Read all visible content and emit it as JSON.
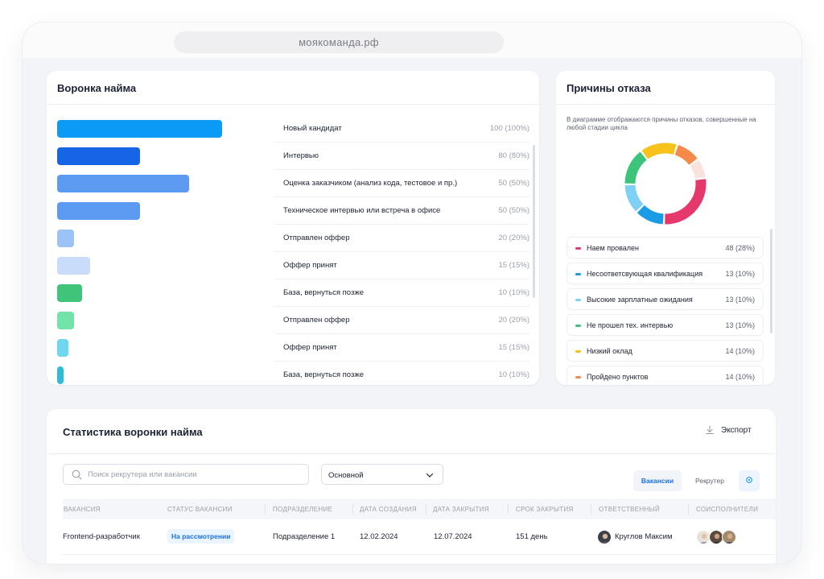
{
  "browser": {
    "url": "моякоманда.рф"
  },
  "funnel": {
    "title": "Воронка найма",
    "rows": [
      {
        "label": "Новый кандидат",
        "value": "100 (100%)",
        "fill": 1.0,
        "color": "#0b9af5"
      },
      {
        "label": "Интервью",
        "value": "80 (80%)",
        "fill": 0.5,
        "color": "#1565e6"
      },
      {
        "label": "Оценка заказчиком (анализ кода, тестовое и пр.)",
        "value": "50 (50%)",
        "fill": 0.8,
        "color": "#5d9af2"
      },
      {
        "label": "Техническое интервью или встреча в офисе",
        "value": "50 (50%)",
        "fill": 0.5,
        "color": "#5d9af2"
      },
      {
        "label": "Отправлен оффер",
        "value": "20 (20%)",
        "fill": 0.1,
        "color": "#9cc3f7"
      },
      {
        "label": "Оффер принят",
        "value": "15 (15%)",
        "fill": 0.2,
        "color": "#c9dcfa"
      },
      {
        "label": "База, вернуться позже",
        "value": "10 (10%)",
        "fill": 0.15,
        "color": "#3fc47a"
      },
      {
        "label": "Отправлен оффер",
        "value": "20 (20%)",
        "fill": 0.1,
        "color": "#72e3a6"
      },
      {
        "label": "Оффер принят",
        "value": "15 (15%)",
        "fill": 0.07,
        "color": "#6ed6ee"
      },
      {
        "label": "База, вернуться позже",
        "value": "10 (10%)",
        "fill": 0.04,
        "color": "#2fbcd8"
      }
    ]
  },
  "reasons": {
    "title": "Причины отказа",
    "description": "В диаграмме отображаются причины отказов, совершенные на любой стадии цикла",
    "items": [
      {
        "label": "Наем провален",
        "value": "48 (28%)",
        "color": "#e6396b"
      },
      {
        "label": "Несоответсвующая квалификация",
        "value": "13 (10%)",
        "color": "#1a9be6"
      },
      {
        "label": "Высокие зарплатные ожидания",
        "value": "13 (10%)",
        "color": "#7fd0f5"
      },
      {
        "label": "Не прошел тех. интервью",
        "value": "13 (10%)",
        "color": "#3cc47a"
      },
      {
        "label": "Низкий оклад",
        "value": "14 (10%)",
        "color": "#f7c31b"
      },
      {
        "label": "Пройдено пунктов",
        "value": "14 (10%)",
        "color": "#f58a4a"
      }
    ],
    "donut": [
      {
        "share": 0.28,
        "color": "#e6396b"
      },
      {
        "share": 0.12,
        "color": "#1a9be6"
      },
      {
        "share": 0.12,
        "color": "#7fd0f5"
      },
      {
        "share": 0.15,
        "color": "#3cc47a"
      },
      {
        "share": 0.15,
        "color": "#f7c31b"
      },
      {
        "share": 0.1,
        "color": "#f58a4a"
      },
      {
        "share": 0.08,
        "color": "#f9e3dc"
      }
    ]
  },
  "stats": {
    "title": "Статистика воронки найма",
    "export_label": "Экспорт",
    "search_placeholder": "Поиск рекрутера или вакансии",
    "select_value": "Основной",
    "segment_active": "Вакансии",
    "segment_other": "Рекрутер",
    "columns": [
      "ВАКАНСИЯ",
      "СТАТУС ВАКАНСИИ",
      "ПОДРАЗДЕЛЕНИЕ",
      "ДАТА СОЗДАНИЯ",
      "ДАТА ЗАКРЫТИЯ",
      "СРОК ЗАКРЫТИЯ",
      "ОТВЕТСТВЕННЫЙ",
      "СОИСПОЛНИТЕЛИ"
    ],
    "row": {
      "vacancy": "Frontend-разработчик",
      "status": "На рассмотрении",
      "department": "Подразделение 1",
      "created": "12.02.2024",
      "closed": "12.07.2024",
      "term": "151 день",
      "responsible": "Круглов Максим"
    }
  },
  "colors": {
    "accent": "#1a73e8",
    "badge_bg": "#eaf4fe"
  }
}
